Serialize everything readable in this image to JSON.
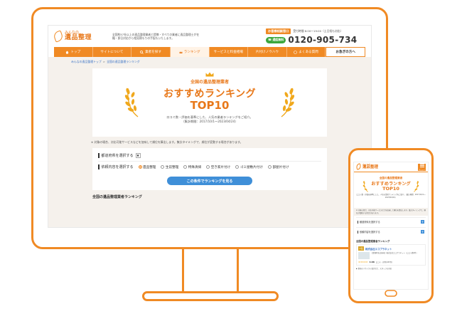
{
  "desktop": {
    "logo": {
      "small": "みんなの",
      "large": "遺品整理"
    },
    "header_desc": "全国約57社以上の遺品整理業者と提携・すべての業者に遺品整理士が在籍・即日対応から相見積もりの手配もいたします。",
    "contact": {
      "badge": "お客様相談窓口",
      "hours": "受付時間 8:00〜19:00（土日祝も対応）",
      "free_badge": "通話無料",
      "phone": "0120-905-734"
    },
    "nav": [
      {
        "label": "トップ",
        "active": false
      },
      {
        "label": "サイトについて",
        "active": false
      },
      {
        "label": "業者を探す",
        "active": false
      },
      {
        "label": "ランキング",
        "active": true
      },
      {
        "label": "サービスと料金相場",
        "active": false
      },
      {
        "label": "片付けノウハウ",
        "active": false
      },
      {
        "label": "よくある質問",
        "active": false
      }
    ],
    "nav_cta": "お急ぎの方へ",
    "breadcrumb": {
      "home": "みんなの遺品整理トップ",
      "sep": ">",
      "current": "全国の遺品整理ランキング"
    },
    "hero": {
      "sub": "全国の遺品整理業者",
      "title": "おすすめランキング",
      "top": "TOP10",
      "desc1": "口コミ数・評価を基準にした、人気の業者ランキングをご紹介。",
      "desc2": "（集計期間：2017/10/1〜2023/04/24）"
    },
    "note": "※ 対象の場合、対応可能サービスなどを加味して順位を算出します。集計タイミングで、順位が変動する場合があります。",
    "filter": {
      "pref_label": "都道府県を選択する",
      "caret": "▼",
      "service_label": "依頼内容を選択する",
      "options": [
        {
          "label": "遺品整理",
          "selected": true
        },
        {
          "label": "生前整理",
          "selected": false
        },
        {
          "label": "特殊清掃",
          "selected": false
        },
        {
          "label": "空き家片付け",
          "selected": false
        },
        {
          "label": "ゴミ屋敷片付け",
          "selected": false
        },
        {
          "label": "部屋片付け",
          "selected": false
        }
      ],
      "button": "この条件でランキングを見る"
    },
    "section_title": "全国の遺品整理業者ランキング"
  },
  "mobile": {
    "logo": {
      "small": "みんなの",
      "large": "遺品整理"
    },
    "menu_label": "メニュー",
    "hero": {
      "sub": "全国の遺品整理業者",
      "title": "おすすめランキング",
      "top": "TOP10",
      "desc": "口コミ数・評価を基準にした、人気の業者ランキングをご紹介。（集計期間：2017/10/1〜2023/04/24）"
    },
    "note": "※ 対象の場合、対応可能サービスなどを加味して順位を算出します。集計タイミングで、順位が変動する場合があります。",
    "pref_label": "都道府県を選択する",
    "service_label": "依頼内容を選択する",
    "plus": "+",
    "section_title": "全国の遺品整理業者ランキング",
    "rank": {
      "num": "1位",
      "name": "株式会社エコプラネット",
      "desc": "【愛知県名古屋市】株式会社エコプラネット（口コミ数4件）",
      "stars": "★★★★★",
      "score": "4.88",
      "reviews": "口コミ・評判(425件)"
    },
    "footer_text": "▶ 事前のリサイクル査定など、スタッフの対応"
  },
  "colors": {
    "accent": "#f08a24",
    "link": "#3a72c5",
    "button": "#3f8fd8",
    "free": "#3ca73c"
  }
}
